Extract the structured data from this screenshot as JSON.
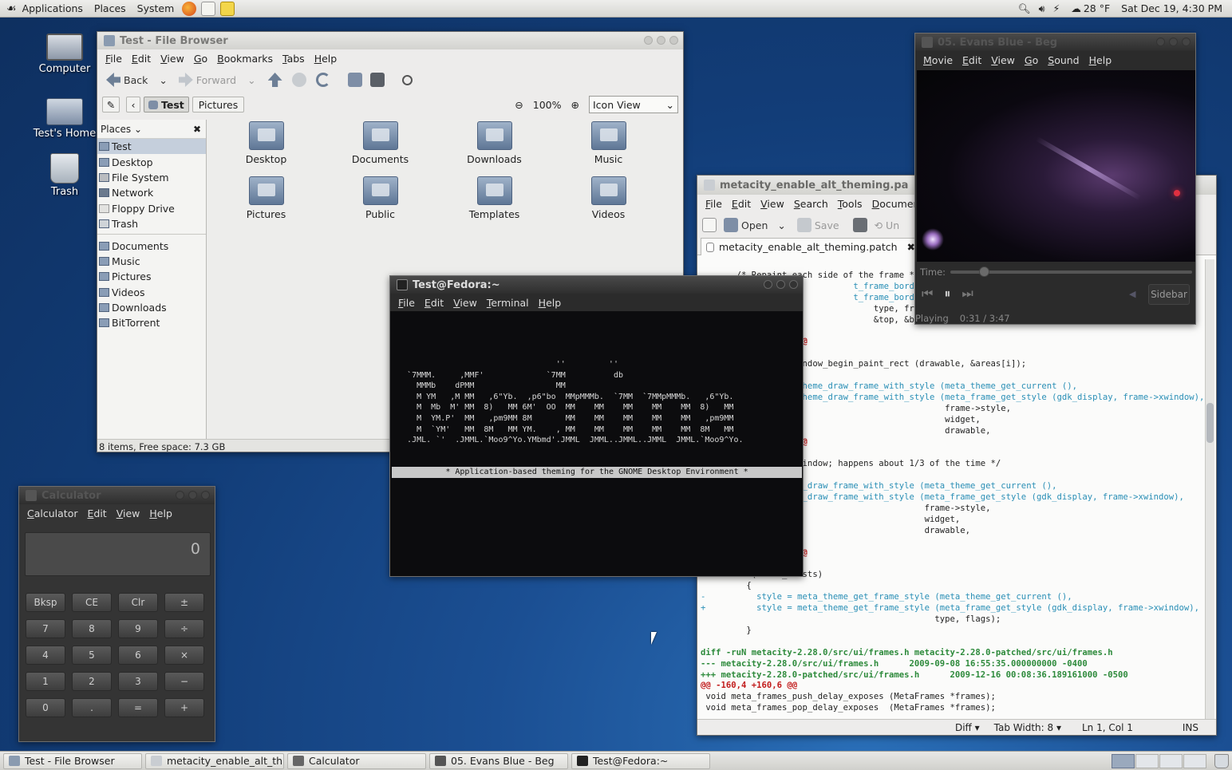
{
  "top_panel": {
    "menus": [
      "Applications",
      "Places",
      "System"
    ],
    "weather": "28 °F",
    "clock": "Sat Dec 19,  4:30 PM"
  },
  "desktop_icons": [
    {
      "label": "Computer"
    },
    {
      "label": "Test's Home"
    },
    {
      "label": "Trash"
    }
  ],
  "file_browser": {
    "title": "Test - File Browser",
    "menus": [
      "File",
      "Edit",
      "View",
      "Go",
      "Bookmarks",
      "Tabs",
      "Help"
    ],
    "toolbar": {
      "back": "Back",
      "forward": "Forward"
    },
    "location": {
      "crumb1": "Test",
      "crumb2": "Pictures",
      "zoom": "100%",
      "view": "Icon View"
    },
    "places_label": "Places",
    "places": [
      "Test",
      "Desktop",
      "File System",
      "Network",
      "Floppy Drive",
      "Trash"
    ],
    "bookmarks": [
      "Documents",
      "Music",
      "Pictures",
      "Videos",
      "Downloads",
      "BitTorrent"
    ],
    "items": [
      "Desktop",
      "Documents",
      "Downloads",
      "Music",
      "Pictures",
      "Public",
      "Templates",
      "Videos"
    ],
    "status": "8 items, Free space: 7.3 GB"
  },
  "terminal": {
    "title": "Test@Fedora:~",
    "menus": [
      "File",
      "Edit",
      "View",
      "Terminal",
      "Help"
    ],
    "art": "                                  ''         ''\n   `7MMM.     ,MMF'             `7MM          db\n     MMMb    dPMM                 MM\n     M YM   ,M MM   ,6\"Yb.  ,p6\"bo  MMpMMMb.  `7MM  `7MMpMMMb.   ,6\"Yb.\n     M  Mb  M' MM  8)   MM 6M'  OO  MM    MM    MM    MM    MM  8)   MM\n     M  YM.P'  MM   ,pm9MM 8M       MM    MM    MM    MM    MM   ,pm9MM\n     M  `YM'   MM  8M   MM YM.    , MM    MM    MM    MM    MM  8M   MM\n   .JML. `'  .JMML.`Moo9^Yo.YMbmd'.JMML  JMML..JMML..JMML  JMML.`Moo9^Yo.",
    "highlight": "* Application-based theming for the GNOME Desktop Environment *"
  },
  "gedit": {
    "title": "metacity_enable_alt_theming.pa",
    "menus": [
      "File",
      "Edit",
      "View",
      "Search",
      "Tools",
      "Documents"
    ],
    "toolbar": {
      "open": "Open",
      "save": "Save",
      "undo": "Un"
    },
    "tab": "metacity_enable_alt_theming.patch",
    "status": {
      "lang": "Diff",
      "tab_width": "Tab Width:  8",
      "pos": "Ln 1, Col 1",
      "mode": "INS"
    }
  },
  "movie_player": {
    "title": "05. Evans Blue - Beg",
    "menus": [
      "Movie",
      "Edit",
      "View",
      "Go",
      "Sound",
      "Help"
    ],
    "time_label": "Time:",
    "sidebar": "Sidebar",
    "status": "Playing",
    "time": "0:31 / 3:47",
    "progress_fraction": 0.14
  },
  "calculator": {
    "title": "Calculator",
    "menus": [
      "Calculator",
      "Edit",
      "View",
      "Help"
    ],
    "display": "0",
    "buttons": [
      "Bksp",
      "CE",
      "Clr",
      "±",
      "7",
      "8",
      "9",
      "÷",
      "4",
      "5",
      "6",
      "×",
      "1",
      "2",
      "3",
      "−",
      "0",
      ".",
      "=",
      "+"
    ]
  },
  "taskbar": [
    "Test - File Browser",
    "metacity_enable_alt_th...",
    "Calculator",
    "05. Evans Blue - Beg",
    "Test@Fedora:~"
  ]
}
